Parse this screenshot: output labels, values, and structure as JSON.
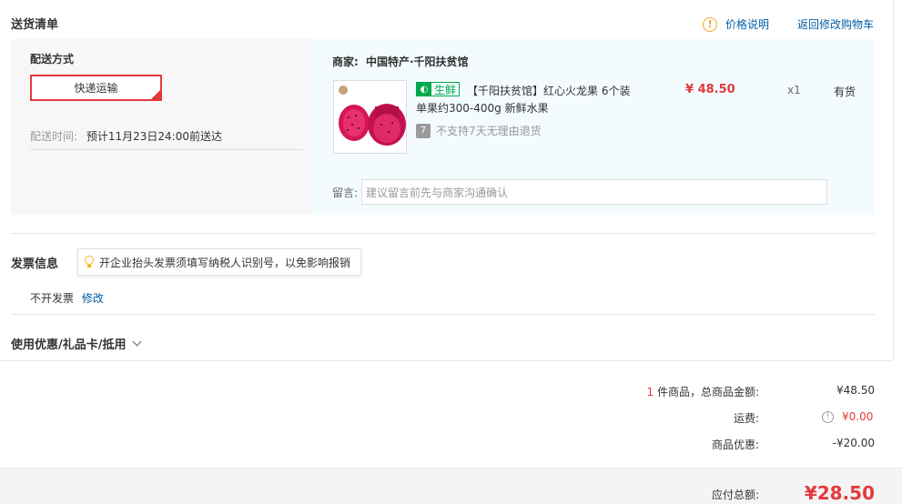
{
  "header": {
    "title": "送货清单",
    "price_note_label": "价格说明",
    "price_note_icon": "warning-icon",
    "back_to_cart_label": "返回修改购物车"
  },
  "delivery": {
    "method_label": "配送方式",
    "method_option": "快递运输",
    "time_label": "配送时间:",
    "time_value": "预计11月23日24:00前送达"
  },
  "shop": {
    "merchant_label": "商家:",
    "merchant_name": "中国特产·千阳扶贫馆",
    "item": {
      "fresh_tag": "生鲜",
      "title_line1": "【千阳扶贫馆】红心火龙果 6个装",
      "title_line2": "单果约300-400g 新鲜水果",
      "no_return_text": "不支持7天无理由退货",
      "price": "¥ 48.50",
      "quantity": "x1",
      "stock": "有货"
    },
    "message_label": "留言:",
    "message_placeholder": "建议留言前先与商家沟通确认"
  },
  "invoice": {
    "title": "发票信息",
    "tip": "开企业抬头发票须填写纳税人识别号，以免影响报销",
    "status": "不开发票",
    "edit_label": "修改"
  },
  "discount": {
    "title": "使用优惠/礼品卡/抵用"
  },
  "summary": {
    "item_count": "1",
    "items_total_label": "件商品，总商品金额:",
    "items_total_value": "¥48.50",
    "shipping_label": "运费:",
    "shipping_value": "¥0.00",
    "discount_label": "商品优惠:",
    "discount_value": "-¥20.00",
    "payable_label": "应付总额:",
    "payable_value": "¥28.50"
  },
  "colors": {
    "accent_red": "#e4393c",
    "link_blue": "#005ea7",
    "fresh_green": "#00a94e",
    "warn_orange": "#f5a623"
  }
}
